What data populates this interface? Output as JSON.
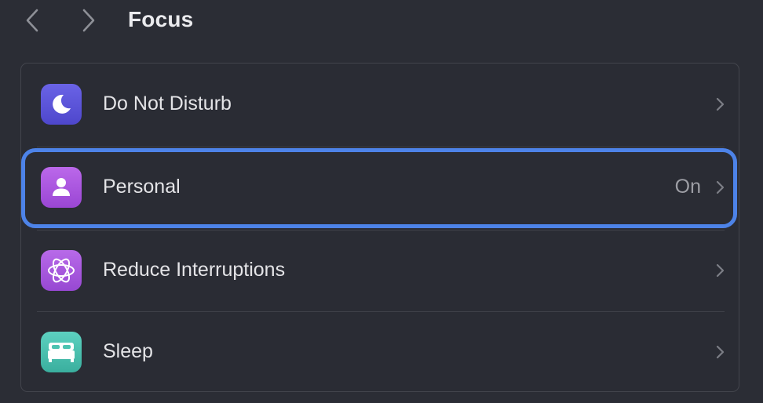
{
  "header": {
    "title": "Focus",
    "back_icon": "chevron-left-icon",
    "forward_icon": "chevron-right-icon"
  },
  "focus_list": {
    "items": [
      {
        "label": "Do Not Disturb",
        "status": "",
        "icon": "moon-icon",
        "icon_color": "#5a52dd",
        "selected": false
      },
      {
        "label": "Personal",
        "status": "On",
        "icon": "person-icon",
        "icon_color": "#ad57e2",
        "selected": true
      },
      {
        "label": "Reduce Interruptions",
        "status": "",
        "icon": "atom-icon",
        "icon_color": "#a858e0",
        "selected": false
      },
      {
        "label": "Sleep",
        "status": "",
        "icon": "bed-icon",
        "icon_color": "#4cc3b1",
        "selected": false
      }
    ]
  },
  "colors": {
    "background": "#2b2d35",
    "focus_ring": "#4d83e8",
    "text_primary": "#e4e4e7",
    "text_secondary": "#9d9ea5"
  }
}
